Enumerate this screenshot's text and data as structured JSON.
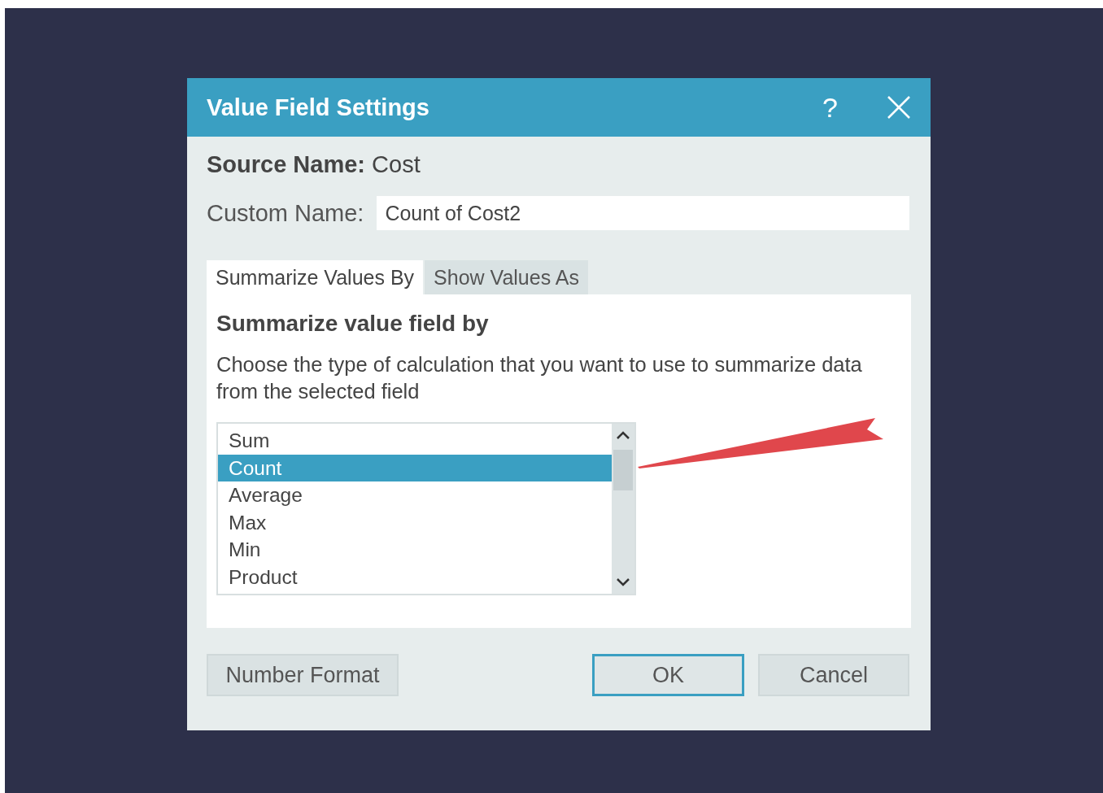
{
  "window": {
    "title": "Value Field Settings",
    "help": "?"
  },
  "source_name": "**Source Name:** Cost",
  "custom_name": {
    "label": "Custom Name:",
    "value": "Count of Cost2"
  },
  "tabs": [
    {
      "label": "Summarize Values By",
      "selected": true
    },
    {
      "label": "Show Values As",
      "selected": false
    }
  ],
  "panel": {
    "heading": "Summarize value field by",
    "description": "Choose the type of calculation that you want to use to summarize data from the selected field",
    "items": [
      {
        "label": "Sum",
        "selected": false
      },
      {
        "label": "Count",
        "selected": true
      },
      {
        "label": "Average",
        "selected": false
      },
      {
        "label": "Max",
        "selected": false
      },
      {
        "label": "Min",
        "selected": false
      },
      {
        "label": "Product",
        "selected": false
      }
    ]
  },
  "buttons": [
    {
      "label": "Number Format",
      "kind": "secondary"
    },
    {
      "label": "OK",
      "kind": "primary"
    },
    {
      "label": "Cancel",
      "kind": "normal"
    }
  ]
}
